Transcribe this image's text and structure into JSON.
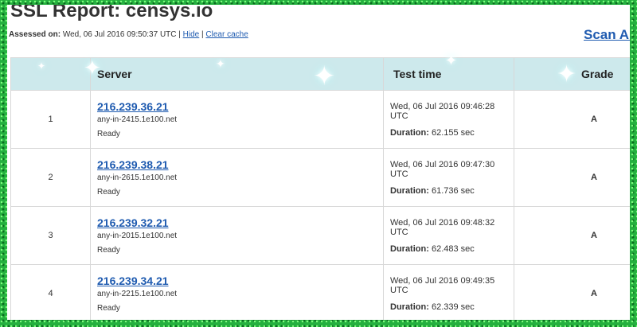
{
  "header": {
    "title": "SSL Report: censys.io",
    "assessed_label": "Assessed on:",
    "assessed_value": "Wed, 06 Jul 2016 09:50:37 UTC",
    "separator": "|",
    "hide_link": "Hide",
    "clear_cache_link": "Clear cache",
    "scan_another": "Scan Another"
  },
  "table": {
    "columns": [
      "",
      "Server",
      "Test time",
      "Grade"
    ],
    "rows": [
      {
        "number": "1",
        "ip": "216.239.36.21",
        "host": "any-in-2415.1e100.net",
        "status": "Ready",
        "time": "Wed, 06 Jul 2016 09:46:28 UTC",
        "duration_label": "Duration:",
        "duration": "62.155 sec",
        "grade": "A"
      },
      {
        "number": "2",
        "ip": "216.239.38.21",
        "host": "any-in-2615.1e100.net",
        "status": "Ready",
        "time": "Wed, 06 Jul 2016 09:47:30 UTC",
        "duration_label": "Duration:",
        "duration": "61.736 sec",
        "grade": "A"
      },
      {
        "number": "3",
        "ip": "216.239.32.21",
        "host": "any-in-2015.1e100.net",
        "status": "Ready",
        "time": "Wed, 06 Jul 2016 09:48:32 UTC",
        "duration_label": "Duration:",
        "duration": "62.483 sec",
        "grade": "A"
      },
      {
        "number": "4",
        "ip": "216.239.34.21",
        "host": "any-in-2215.1e100.net",
        "status": "Ready",
        "time": "Wed, 06 Jul 2016 09:49:35 UTC",
        "duration_label": "Duration:",
        "duration": "62.339 sec",
        "grade": "A"
      }
    ]
  },
  "colors": {
    "link": "#1f5bb0",
    "grade_a": "#80c342",
    "header_bg": "#cde9ec",
    "glitter_frame": "#25b03f"
  },
  "decorations": {
    "frame": "green-glitter-border",
    "sparkle_glyph": "✦"
  }
}
